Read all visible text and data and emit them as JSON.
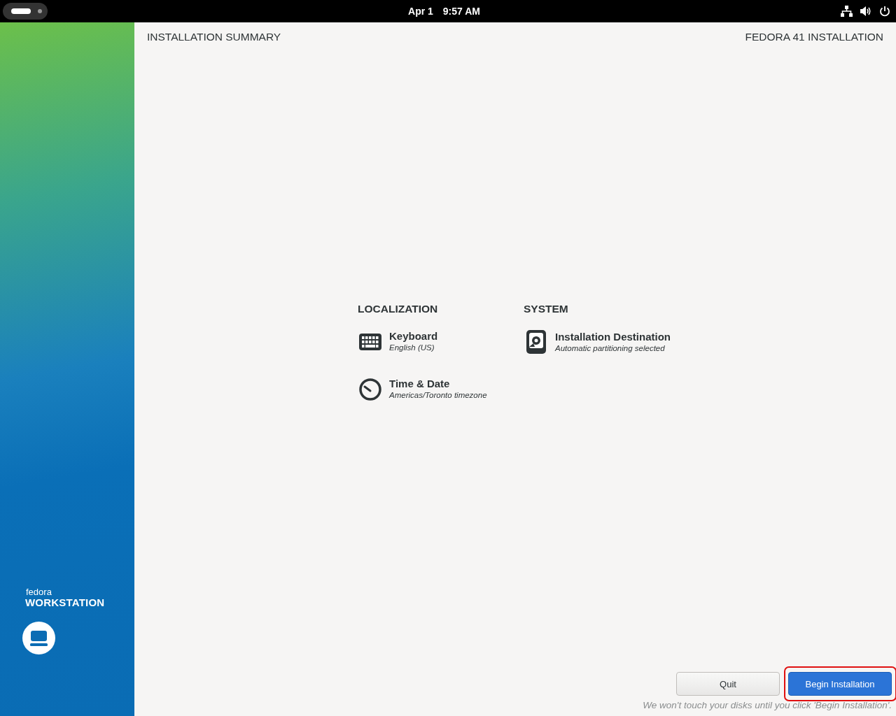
{
  "top_bar": {
    "date": "Apr 1",
    "time": "9:57 AM"
  },
  "sidebar": {
    "brand_small": "fedora",
    "brand_large": "WORKSTATION"
  },
  "header": {
    "title": "INSTALLATION SUMMARY",
    "product": "FEDORA 41 INSTALLATION"
  },
  "sections": [
    {
      "title": "LOCALIZATION",
      "spokes": [
        {
          "kind": "keyboard",
          "title": "Keyboard",
          "status": "English (US)"
        },
        {
          "kind": "clock",
          "title": "Time & Date",
          "status": "Americas/Toronto timezone"
        }
      ]
    },
    {
      "title": "SYSTEM",
      "spokes": [
        {
          "kind": "disk",
          "title": "Installation Destination",
          "status": "Automatic partitioning selected"
        }
      ]
    }
  ],
  "buttons": [
    {
      "kind": "secondary",
      "label": "Quit",
      "highlighted": false
    },
    {
      "kind": "primary",
      "label": "Begin Installation",
      "highlighted": true
    }
  ],
  "footer_note": "We won't touch your disks until you click 'Begin Installation'."
}
